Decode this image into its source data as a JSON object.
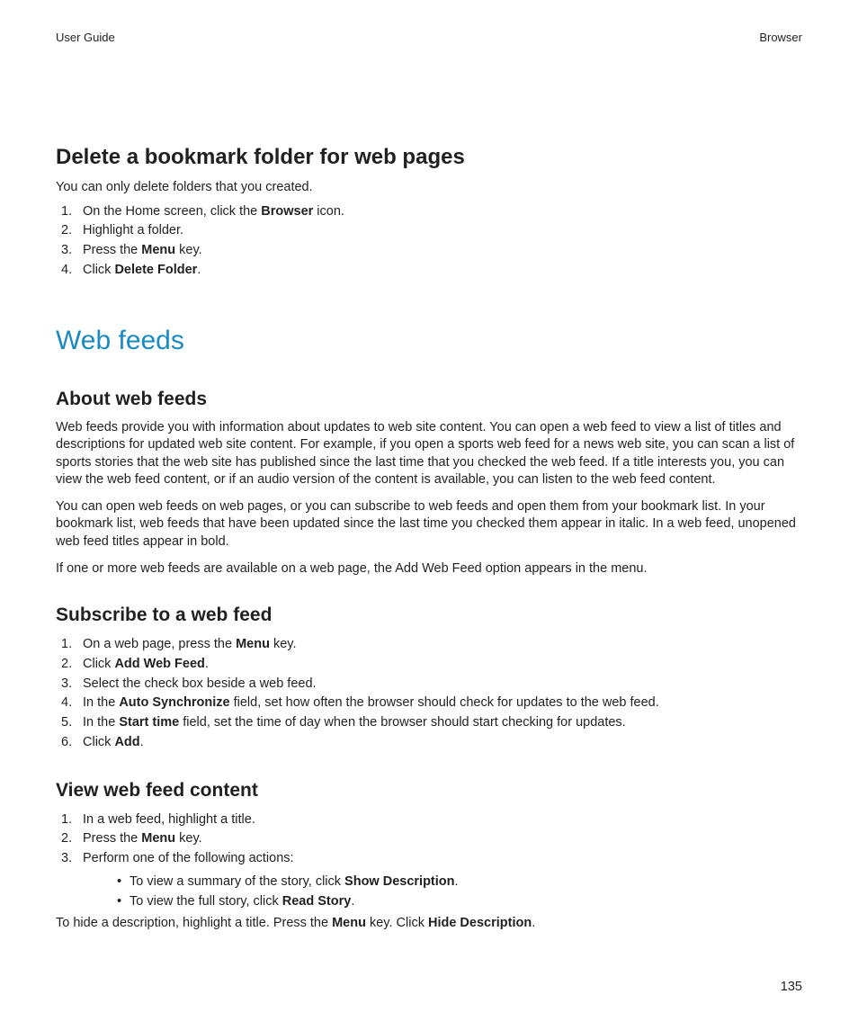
{
  "header": {
    "left": "User Guide",
    "right": "Browser"
  },
  "section1": {
    "title": "Delete a bookmark folder for web pages",
    "intro": "You can only delete folders that you created.",
    "steps": {
      "s1a": "On the Home screen, click the ",
      "s1b": "Browser",
      "s1c": " icon.",
      "s2": "Highlight a folder.",
      "s3a": "Press the ",
      "s3b": "Menu",
      "s3c": " key.",
      "s4a": "Click ",
      "s4b": "Delete Folder",
      "s4c": "."
    }
  },
  "h1": "Web feeds",
  "section2": {
    "title": "About web feeds",
    "p1": "Web feeds provide you with information about updates to web site content. You can open a web feed to view a list of titles and descriptions for updated web site content. For example, if you open a sports web feed for a news web site, you can scan a list of sports stories that the web site has published since the last time that you checked the web feed. If a title interests you, you can view the web feed content, or if an audio version of the content is available, you can listen to the web feed content.",
    "p2": "You can open web feeds on web pages, or you can subscribe to web feeds and open them from your bookmark list. In your bookmark list, web feeds that have been updated since the last time you checked them appear in italic. In a web feed, unopened web feed titles appear in bold.",
    "p3": "If one or more web feeds are available on a web page, the Add Web Feed option appears in the menu."
  },
  "section3": {
    "title": "Subscribe to a web feed",
    "steps": {
      "s1a": "On a web page, press the ",
      "s1b": "Menu",
      "s1c": " key.",
      "s2a": "Click ",
      "s2b": "Add Web Feed",
      "s2c": ".",
      "s3": "Select the check box beside a web feed.",
      "s4a": "In the ",
      "s4b": "Auto Synchronize",
      "s4c": " field, set how often the browser should check for updates to the web feed.",
      "s5a": "In the ",
      "s5b": "Start time",
      "s5c": " field, set the time of day when the browser should start checking for updates.",
      "s6a": "Click ",
      "s6b": "Add",
      "s6c": "."
    }
  },
  "section4": {
    "title": "View web feed content",
    "steps": {
      "s1": "In a web feed, highlight a title.",
      "s2a": "Press the ",
      "s2b": "Menu",
      "s2c": " key.",
      "s3": "Perform one of the following actions:"
    },
    "bullets": {
      "b1a": "To view a summary of the story, click ",
      "b1b": "Show Description",
      "b1c": ".",
      "b2a": "To view the full story, click ",
      "b2b": "Read Story",
      "b2c": "."
    },
    "footer": {
      "a": "To hide a description, highlight a title. Press the ",
      "b": "Menu",
      "c": " key. Click ",
      "d": "Hide Description",
      "e": "."
    }
  },
  "pageNumber": "135"
}
